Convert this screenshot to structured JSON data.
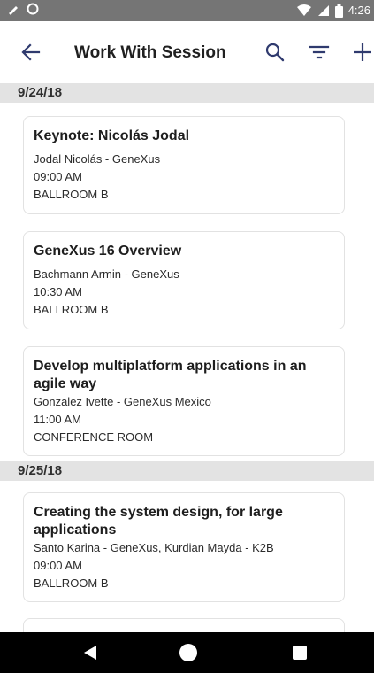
{
  "status_bar": {
    "time": "4:26",
    "icons": [
      "pen-icon",
      "circle-icon",
      "wifi-icon",
      "signal-icon",
      "battery-icon"
    ]
  },
  "app_bar": {
    "title": "Work With Session",
    "icons": [
      "back-arrow-icon",
      "search-icon",
      "filter-icon",
      "add-icon"
    ]
  },
  "sections": [
    {
      "date": "9/24/18",
      "sessions": [
        {
          "title": "Keynote: Nicolás Jodal",
          "speakers": "Jodal Nicolás - GeneXus",
          "time": "09:00 AM",
          "room": "BALLROOM B"
        },
        {
          "title": "GeneXus 16 Overview",
          "speakers": "Bachmann Armin - GeneXus",
          "time": "10:30 AM",
          "room": "BALLROOM B"
        },
        {
          "title_line1": "Develop multiplatform applications in an",
          "title_line2": "agile way",
          "speakers": "Gonzalez Ivette - GeneXus Mexico",
          "time": "11:00 AM",
          "room": "CONFERENCE ROOM"
        }
      ]
    },
    {
      "date": "9/25/18",
      "sessions": [
        {
          "title_line1": "Creating the system design, for large",
          "title_line2": "applications",
          "speakers": "Santo Karina - GeneXus, Kurdian Mayda - K2B",
          "time": "09:00 AM",
          "room": "BALLROOM B"
        }
      ]
    }
  ],
  "colors": {
    "status_bar": "#757575",
    "date_header": "#e3e3e3",
    "card_border": "#e2e2e2",
    "nav_bar": "#000000",
    "accent_icon": "#2f3a6e"
  }
}
